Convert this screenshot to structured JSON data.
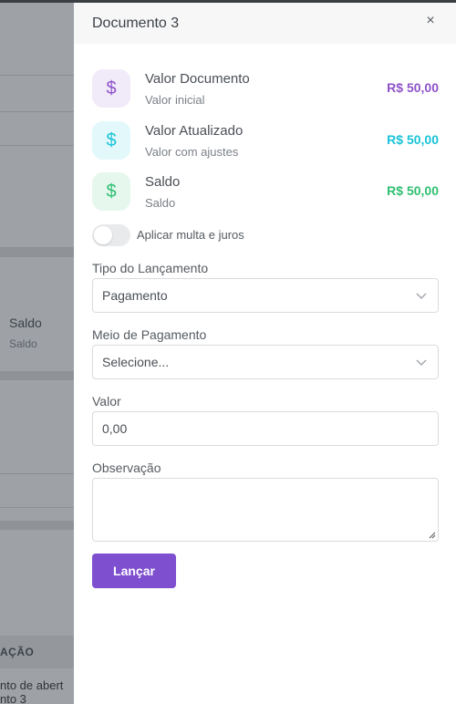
{
  "background": {
    "saldo_title": "Saldo",
    "saldo_sub": "Saldo",
    "table_header_fragment": "AÇÃO",
    "row_line1": "nto de abert",
    "row_line2": "nto 3"
  },
  "panel": {
    "title": "Documento 3",
    "close_glyph": "×"
  },
  "summary": [
    {
      "title": "Valor Documento",
      "subtitle": "Valor inicial",
      "value": "R$ 50,00",
      "icon": "dollar-icon",
      "glyph": "$",
      "color": "#8e53c9",
      "bg": "#f1eaf9"
    },
    {
      "title": "Valor Atualizado",
      "subtitle": "Valor com ajustes",
      "value": "R$ 50,00",
      "icon": "dollar-icon",
      "glyph": "$",
      "color": "#19c3d8",
      "bg": "#e3f8fb"
    },
    {
      "title": "Saldo",
      "subtitle": "Saldo",
      "value": "R$ 50,00",
      "icon": "dollar-icon",
      "glyph": "$",
      "color": "#2fbf71",
      "bg": "#e6f7ee"
    }
  ],
  "toggle": {
    "label": "Aplicar multa e juros",
    "checked": false
  },
  "form": {
    "tipo_label": "Tipo do Lançamento",
    "tipo_value": "Pagamento",
    "meio_label": "Meio de Pagamento",
    "meio_value": "Selecione...",
    "valor_label": "Valor",
    "valor_value": "0,00",
    "obs_label": "Observação",
    "obs_value": ""
  },
  "actions": {
    "submit_label": "Lançar"
  }
}
